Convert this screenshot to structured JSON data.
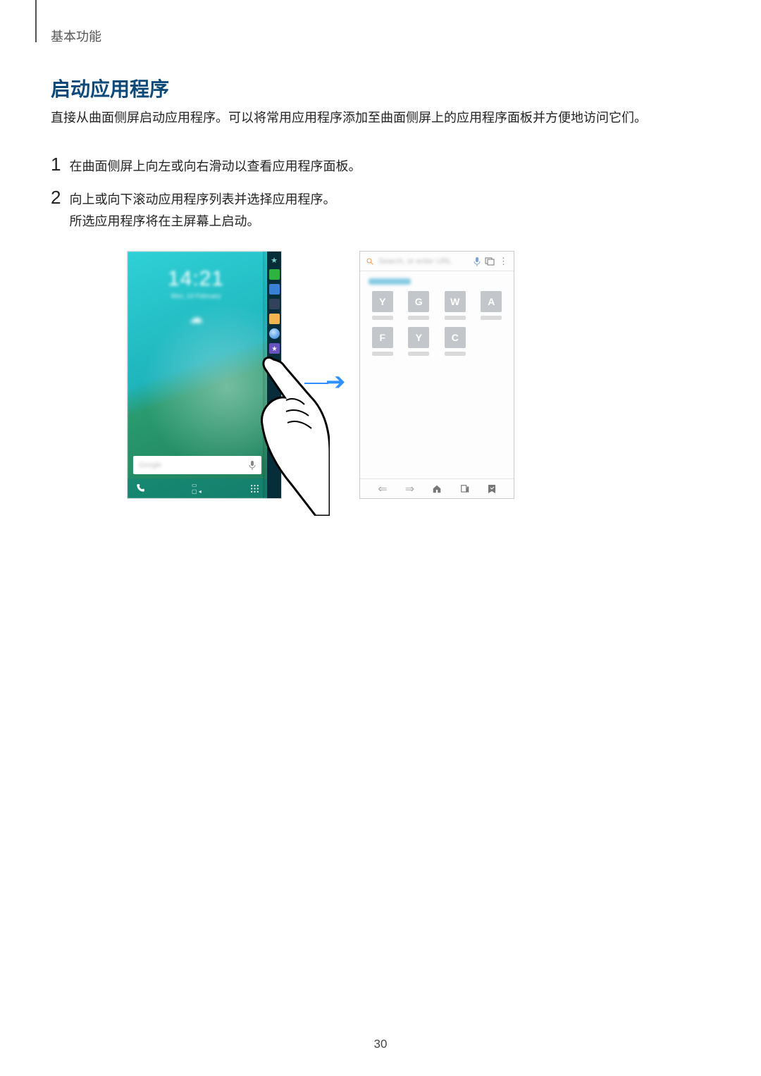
{
  "header": {
    "breadcrumb": "基本功能"
  },
  "title": "启动应用程序",
  "intro": "直接从曲面侧屏启动应用程序。可以将常用应用程序添加至曲面侧屏上的应用程序面板并方便地访问它们。",
  "steps": {
    "s1": {
      "num": "1",
      "text": "在曲面侧屏上向左或向右滑动以查看应用程序面板。"
    },
    "s2": {
      "num": "2",
      "text_a": "向上或向下滚动应用程序列表并选择应用程序。",
      "text_b": "所选应用程序将在主屏幕上启动。"
    }
  },
  "left_screen": {
    "time": "14:21",
    "date": "Mon, 14 February",
    "search_label": "Google",
    "edge_header_icon": "star"
  },
  "right_screen": {
    "quick_access_label": "Quick access",
    "search_placeholder": "Search, or enter URL",
    "tiles": [
      "Y",
      "G",
      "W",
      "A",
      "F",
      "Y",
      "C"
    ]
  },
  "page_number": "30"
}
